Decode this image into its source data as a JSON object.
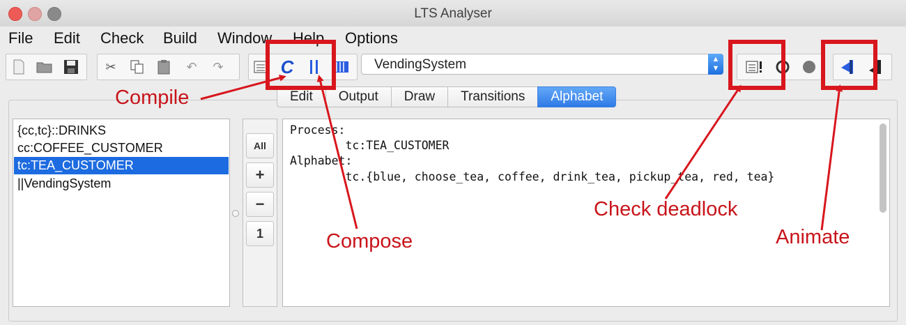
{
  "window": {
    "title": "LTS Analyser"
  },
  "menu": [
    "File",
    "Edit",
    "Check",
    "Build",
    "Window",
    "Help",
    "Options"
  ],
  "toolbar": {
    "target_value": "VendingSystem",
    "icons": [
      "new-file-icon",
      "open-folder-icon",
      "save-icon",
      "cut-icon",
      "copy-icon",
      "paste-icon",
      "undo-icon",
      "redo-icon",
      "clear-output-icon",
      "compile-icon",
      "compose-icon",
      "minimise-icon",
      "check-deadlock-icon",
      "check-progress-icon",
      "stop-icon",
      "animate-icon",
      "run-icon"
    ]
  },
  "tabs": [
    "Edit",
    "Output",
    "Draw",
    "Transitions",
    "Alphabet"
  ],
  "active_tab": "Alphabet",
  "process_list": [
    "{cc,tc}::DRINKS",
    "cc:COFFEE_CUSTOMER",
    "tc:TEA_CUSTOMER",
    "||VendingSystem"
  ],
  "selected_process": "tc:TEA_CUSTOMER",
  "side_buttons": [
    "All",
    "+",
    "−",
    "1"
  ],
  "output": {
    "line1": "Process:",
    "line2": "        tc:TEA_CUSTOMER",
    "line3": "Alphabet:",
    "line4": "        tc.{blue, choose_tea, coffee, drink_tea, pickup_tea, red, tea}"
  },
  "annotations": {
    "compile": "Compile",
    "compose": "Compose",
    "check_deadlock": "Check deadlock",
    "animate": "Animate",
    "color": "#d8161d"
  }
}
